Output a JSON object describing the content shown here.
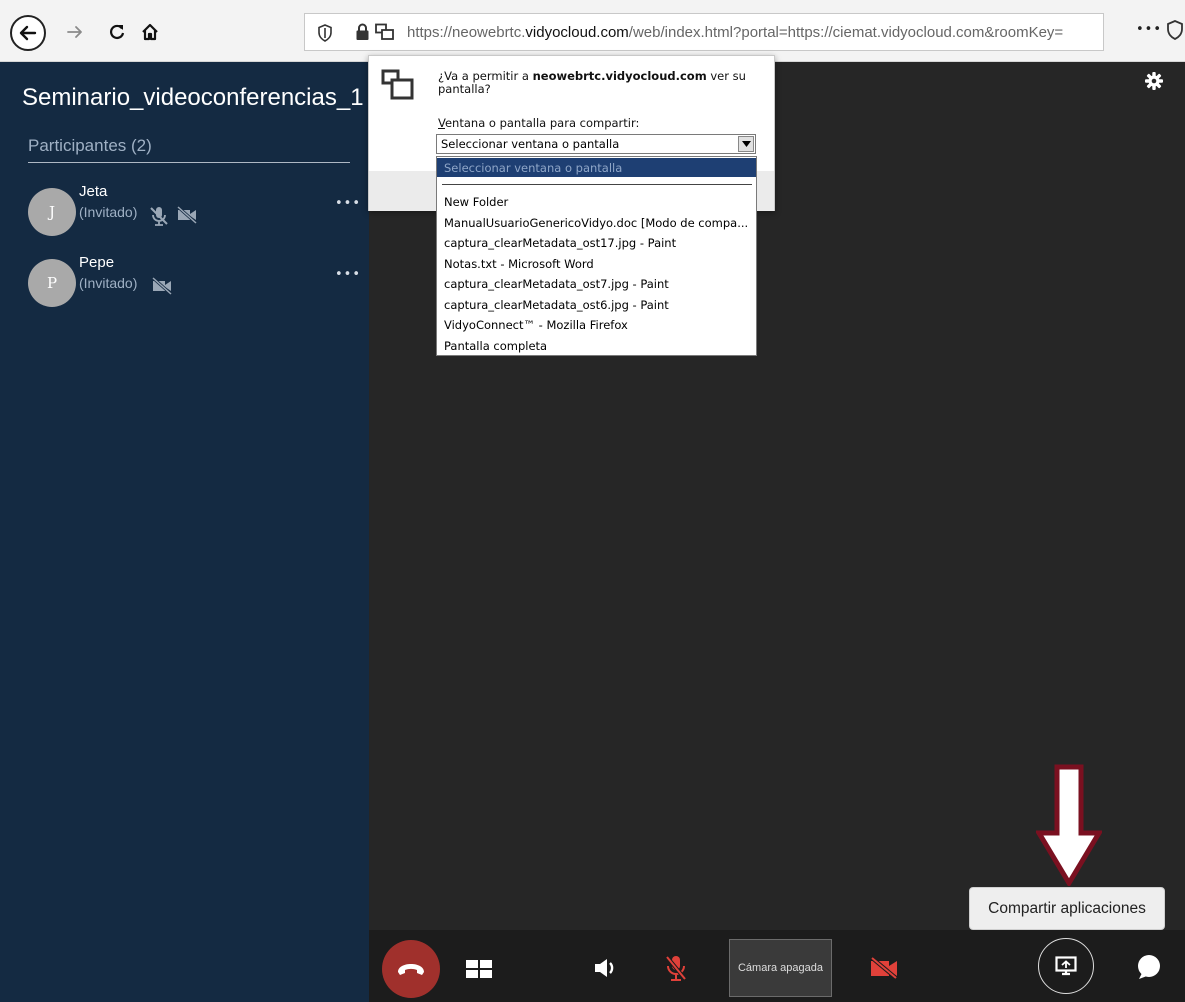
{
  "browser": {
    "url_prefix": "https://neowebrtc.",
    "url_domain": "vidyocloud.com",
    "url_suffix": "/web/index.html?portal=https://ciemat.vidyocloud.com&roomKey=",
    "more_label": "•••"
  },
  "sidebar": {
    "room_title": "Seminario_videoconferencias_1",
    "participants_header": "Participantes (2)",
    "participants": [
      {
        "initial": "J",
        "name": "Jeta",
        "role": "(Invitado)",
        "more": "•••"
      },
      {
        "initial": "P",
        "name": "Pepe",
        "role": "(Invitado)",
        "more": "•••"
      }
    ]
  },
  "share_prompt": {
    "question_prefix": "¿Va a permitir a ",
    "question_domain": "neowebrtc.vidyocloud.com",
    "question_suffix": " ver su pantalla?",
    "label_accesskey": "V",
    "label_rest": "entana o pantalla para compartir:",
    "select_value": "Seleccionar ventana o pantalla",
    "options": [
      "Seleccionar ventana o pantalla",
      "New Folder",
      "ManualUsuarioGenericoVidyo.doc [Modo de compa...",
      "captura_clearMetadata_ost17.jpg - Paint",
      "Notas.txt - Microsoft Word",
      "captura_clearMetadata_ost7.jpg - Paint",
      "captura_clearMetadata_ost6.jpg - Paint",
      "VidyoConnect™ - Mozilla Firefox",
      "Pantalla completa"
    ]
  },
  "tooltip": {
    "text": "Compartir aplicaciones"
  },
  "controls": {
    "camera_off_label": "Cámara apagada",
    "icons": [
      "hangup-icon",
      "layout-icon",
      "speaker-icon",
      "mic-muted-icon",
      "camera-off-icon",
      "share-screen-icon",
      "chat-icon"
    ]
  },
  "colors": {
    "sidebar_bg": "#142a42",
    "main_bg": "#262626",
    "hangup_red": "#a0302c",
    "muted_red": "#e0413a",
    "annotation_arrow": "#7a1020"
  }
}
